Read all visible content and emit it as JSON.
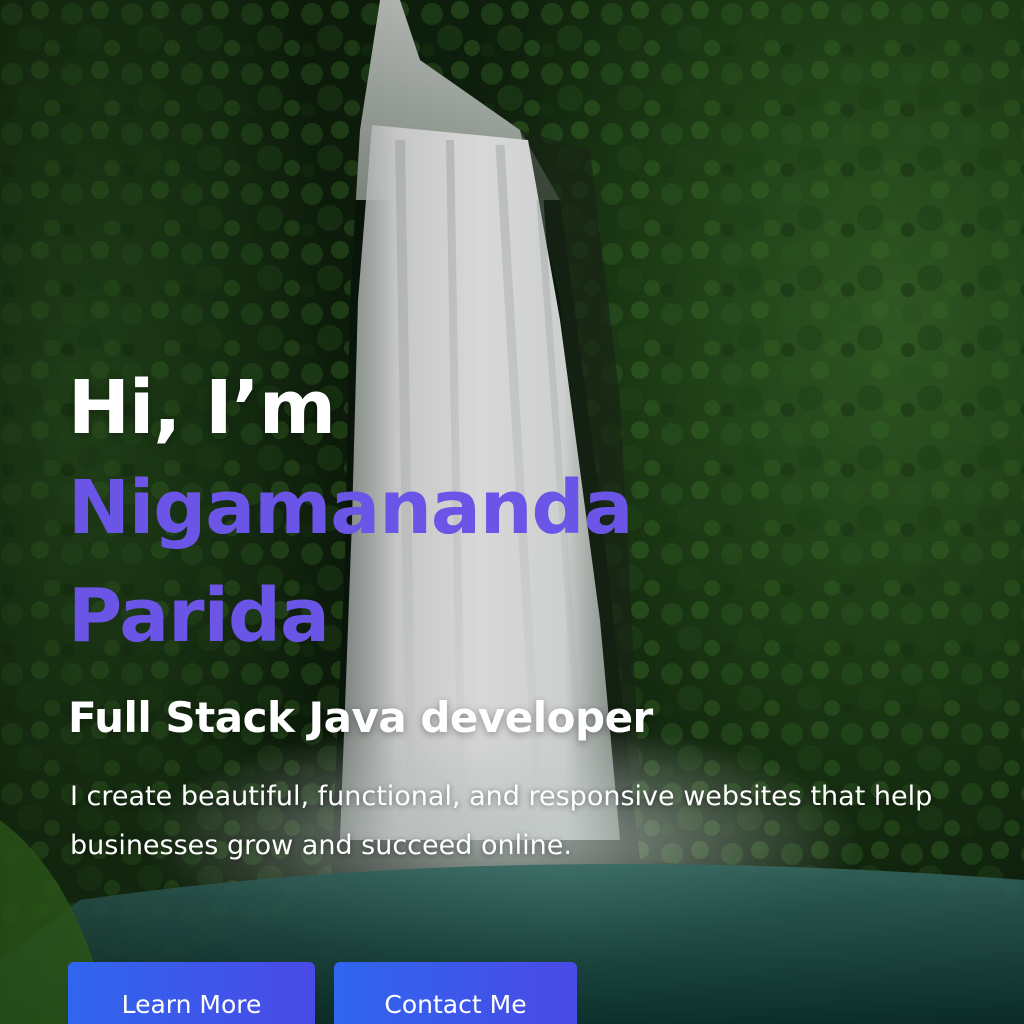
{
  "hero": {
    "greeting": "Hi, I’m",
    "name": "Nigamananda Parida",
    "role": "Full Stack Java developer",
    "tagline": "I create beautiful, functional, and responsive websites that help businesses grow and succeed online.",
    "buttons": {
      "learn_more": "Learn More",
      "contact_me": "Contact Me"
    }
  },
  "colors": {
    "name_accent": "#6a55e6",
    "button_gradient_start": "#2f66ee",
    "button_gradient_end": "#4a4ae6",
    "text": "#ffffff"
  }
}
